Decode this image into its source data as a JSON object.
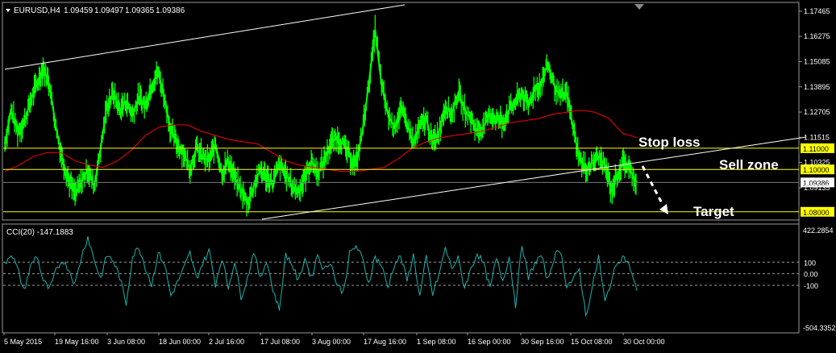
{
  "header": {
    "menu_icon": "triangle-down-icon",
    "symbol": "EURUSD,H4",
    "open": "1.09459",
    "high": "1.09497",
    "low": "1.09365",
    "close": "1.09386"
  },
  "annotations": {
    "stop_loss": "Stop loss",
    "sell_zone": "Sell zone",
    "target": "Target"
  },
  "indicator": {
    "label": "CCI(20) -147.1883",
    "levels": [
      100,
      0,
      -100
    ],
    "level_labels": [
      "100",
      "0.00",
      "-100"
    ],
    "top_label": "422.2854",
    "bottom_label": "-504.3352"
  },
  "colors": {
    "background": "#000000",
    "candles": "#00ff00",
    "ma": "#ff0000",
    "channel": "#ffffff",
    "hlines": "#ffff00",
    "cci": "#20b2aa",
    "price_tag_bg": "#ffff00",
    "current_tag_bg": "#ffffff"
  },
  "chart_data": [
    {
      "type": "line",
      "title": "EURUSD,H4",
      "ylim": [
        1.0765,
        1.1784
      ],
      "y_ticks": [
        "1.17465",
        "1.16275",
        "1.15085",
        "1.13895",
        "1.12705",
        "1.11515",
        "1.10325",
        "1.09135"
      ],
      "x_ticks": [
        "5 May 2015",
        "19 May 16:00",
        "3 Jun 08:00",
        "18 Jun 00:00",
        "2 Jul 16:00",
        "17 Jul 08:00",
        "3 Aug 00:00",
        "17 Aug 16:00",
        "1 Sep 08:00",
        "16 Sep 00:00",
        "30 Sep 16:00",
        "15 Oct 08:00",
        "30 Oct 00:00"
      ],
      "series": [
        {
          "values": [
            1.112,
            1.128,
            1.118,
            1.122,
            1.132,
            1.14,
            1.148,
            1.14,
            1.12,
            1.105,
            1.095,
            1.088,
            1.094,
            1.1,
            1.092,
            1.11,
            1.13,
            1.136,
            1.128,
            1.132,
            1.126,
            1.134,
            1.13,
            1.14,
            1.146,
            1.134,
            1.118,
            1.112,
            1.108,
            1.1,
            1.11,
            1.106,
            1.104,
            1.112,
            1.098,
            1.104,
            1.096,
            1.09,
            1.084,
            1.092,
            1.1,
            1.096,
            1.094,
            1.102,
            1.098,
            1.092,
            1.09,
            1.096,
            1.104,
            1.098,
            1.104,
            1.112,
            1.115,
            1.112,
            1.106,
            1.102,
            1.118,
            1.14,
            1.166,
            1.14,
            1.126,
            1.12,
            1.128,
            1.122,
            1.112,
            1.12,
            1.124,
            1.112,
            1.118,
            1.13,
            1.126,
            1.136,
            1.128,
            1.124,
            1.118,
            1.12,
            1.126,
            1.124,
            1.122,
            1.128,
            1.132,
            1.136,
            1.13,
            1.138,
            1.14,
            1.15,
            1.14,
            1.134,
            1.136,
            1.12,
            1.105,
            1.1,
            1.103,
            1.106,
            1.102,
            1.09,
            1.098,
            1.104,
            1.099,
            1.0939
          ]
        },
        {
          "values": [
            1.099,
            1.102,
            1.106,
            1.108,
            1.108,
            1.104,
            1.102,
            1.101,
            1.104,
            1.109,
            1.116,
            1.12,
            1.121,
            1.121,
            1.118,
            1.116,
            1.114,
            1.113,
            1.112,
            1.108,
            1.104,
            1.102,
            1.101,
            1.1,
            1.099,
            1.099,
            1.1,
            1.101,
            1.105,
            1.11,
            1.113,
            1.115,
            1.116,
            1.117,
            1.118,
            1.12,
            1.122,
            1.123,
            1.124,
            1.126,
            1.127,
            1.128,
            1.127,
            1.124,
            1.117,
            1.115
          ]
        }
      ],
      "horizontal_lines": [
        1.11,
        1.1,
        1.08
      ],
      "horizontal_line_labels": [
        "1.11000",
        "1.10000",
        "1.08000"
      ],
      "current_price": 1.09386,
      "current_price_label": "1.09386"
    },
    {
      "type": "line",
      "title": "CCI(20) -147.1883",
      "ylim": [
        -504.3352,
        422.2854
      ],
      "levels": [
        100,
        0,
        -100
      ],
      "series": [
        {
          "values": [
            90,
            180,
            40,
            -150,
            60,
            160,
            -60,
            -140,
            20,
            120,
            40,
            -90,
            150,
            320,
            120,
            -40,
            160,
            110,
            -30,
            -260,
            150,
            230,
            60,
            -100,
            180,
            90,
            -190,
            -80,
            40,
            180,
            -40,
            90,
            200,
            -90,
            140,
            -120,
            110,
            -200,
            -40,
            200,
            -50,
            120,
            -140,
            -310,
            170,
            80,
            -70,
            140,
            -40,
            170,
            30,
            110,
            -90,
            -160,
            170,
            240,
            130,
            -80,
            150,
            70,
            -120,
            80,
            150,
            -60,
            160,
            -200,
            140,
            -180,
            -10,
            220,
            50,
            130,
            -120,
            40,
            180,
            80,
            -130,
            130,
            -60,
            150,
            -270,
            260,
            -40,
            90,
            160,
            -60,
            140,
            210,
            -100,
            -60,
            40,
            -360,
            -130,
            150,
            -250,
            -60,
            110,
            150,
            40,
            -147
          ]
        }
      ]
    }
  ]
}
